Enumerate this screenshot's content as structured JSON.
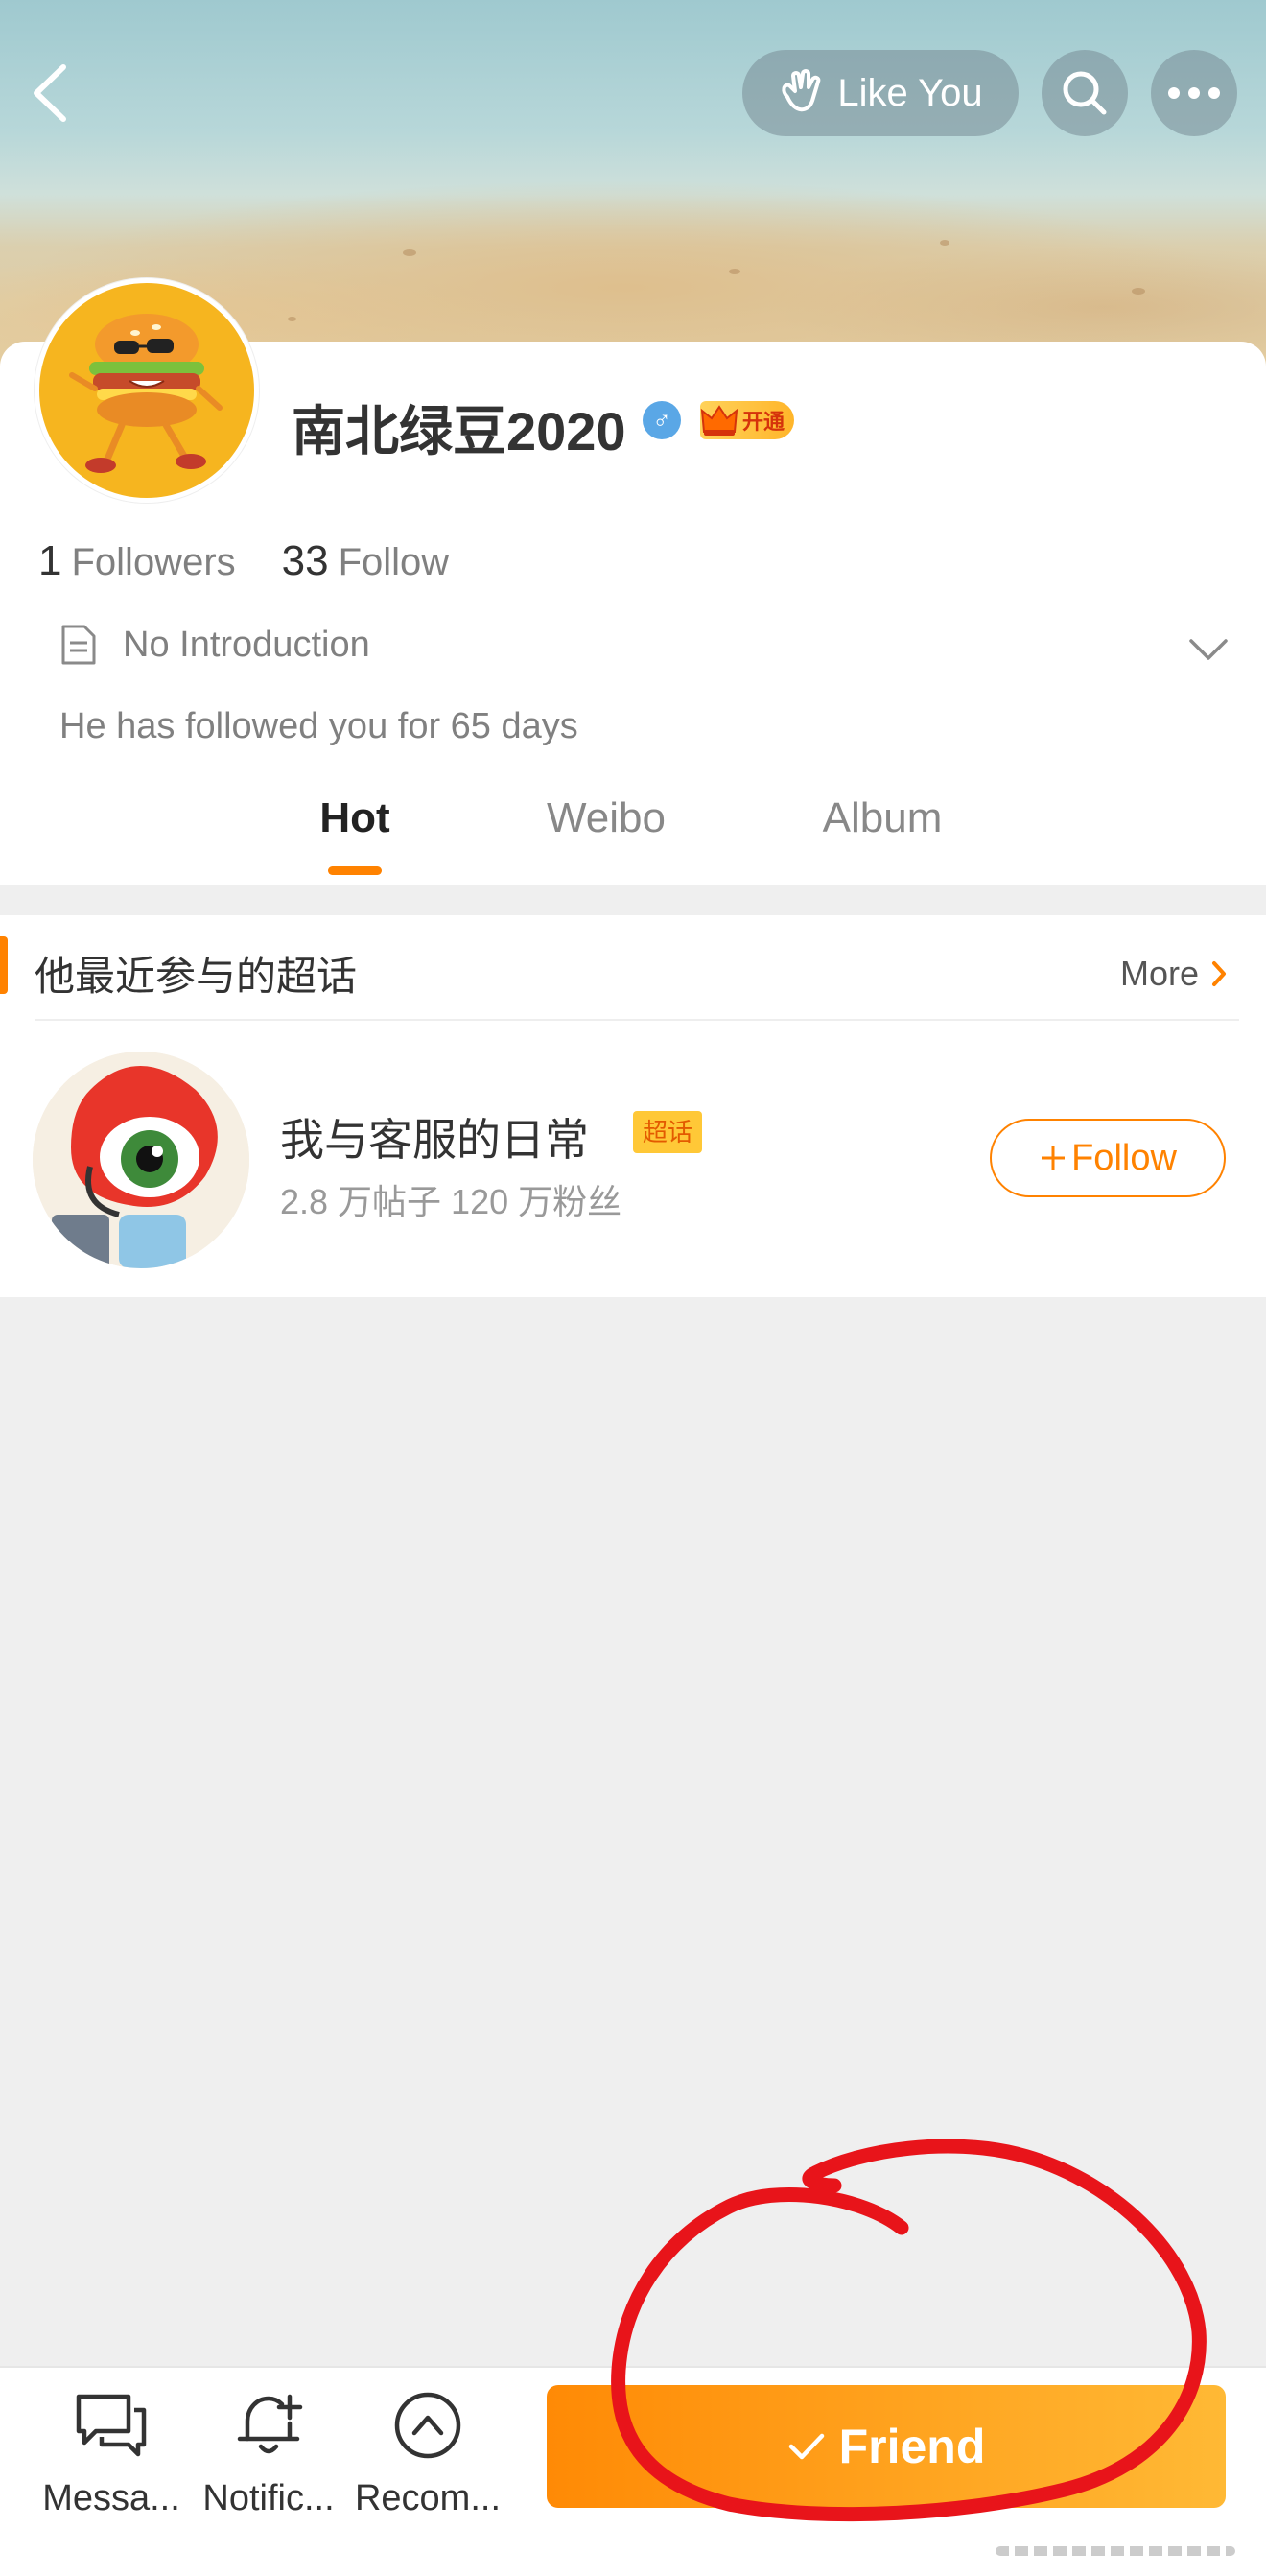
{
  "header": {
    "like_you_label": "Like You"
  },
  "profile": {
    "username": "南北绿豆2020",
    "gender_symbol": "♂",
    "vip_label": "开通",
    "followers_count": "1",
    "followers_label": "Followers",
    "follow_count": "33",
    "follow_label": "Follow",
    "intro": "No Introduction",
    "followed_note": "He has followed you for 65 days"
  },
  "tabs": [
    {
      "label": "Hot",
      "active": true
    },
    {
      "label": "Weibo",
      "active": false
    },
    {
      "label": "Album",
      "active": false
    }
  ],
  "super_topics": {
    "section_title": "他最近参与的超话",
    "more_label": "More",
    "items": [
      {
        "name": "我与客服的日常",
        "tag": "超话",
        "stats": "2.8 万帖子  120 万粉丝",
        "follow_label": "Follow"
      }
    ]
  },
  "bottom_bar": {
    "message_label": "Messa...",
    "notification_label": "Notific...",
    "recommend_label": "Recom...",
    "friend_label": "Friend"
  },
  "colors": {
    "accent": "#ff8200",
    "annotation": "#e8141a"
  }
}
